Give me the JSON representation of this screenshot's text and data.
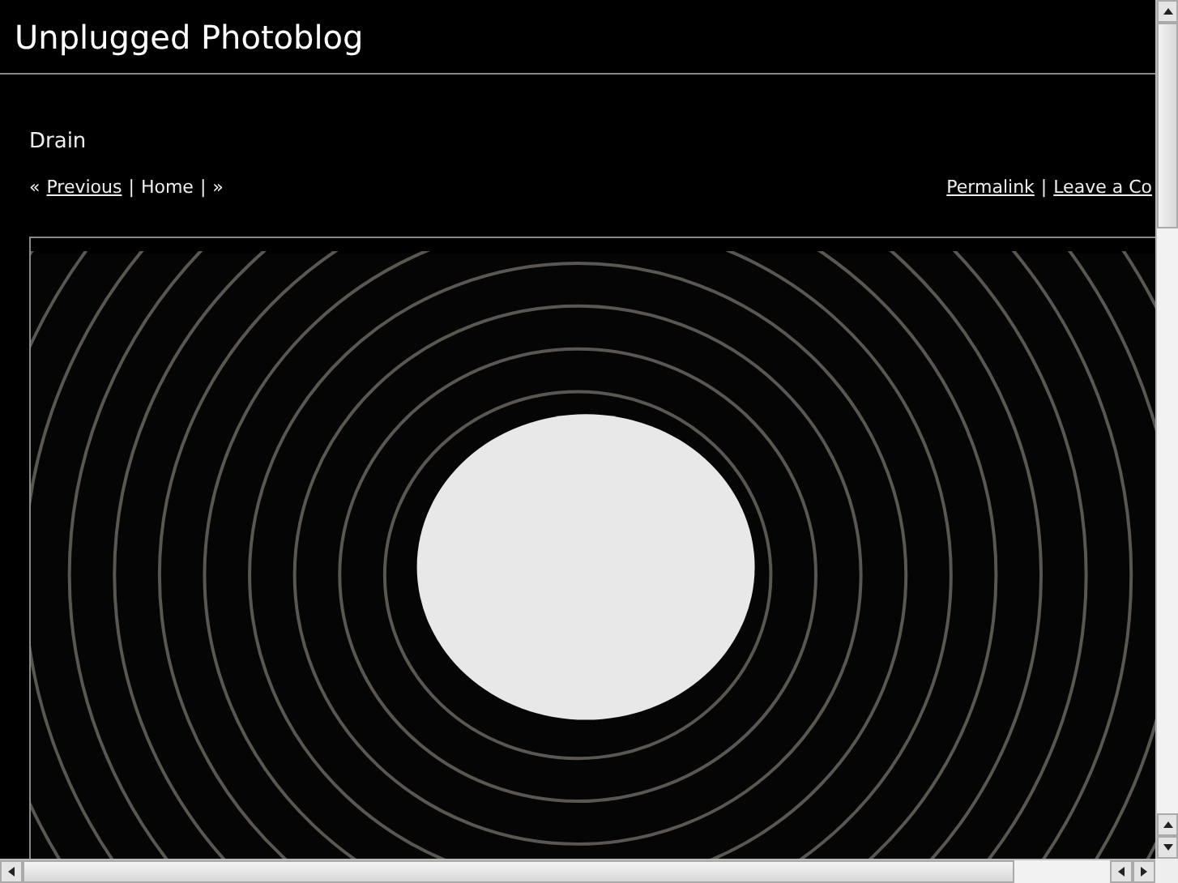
{
  "site_title": "Unplugged Photoblog",
  "post_title": "Drain",
  "nav_left": [
    {
      "kind": "text",
      "text": "«"
    },
    {
      "kind": "link",
      "text": "Previous"
    },
    {
      "kind": "separator",
      "text": "|"
    },
    {
      "kind": "text",
      "text": "Home"
    },
    {
      "kind": "separator",
      "text": "|"
    },
    {
      "kind": "text",
      "text": "»"
    }
  ],
  "nav_right": [
    {
      "kind": "link",
      "text": "Permalink"
    },
    {
      "kind": "separator",
      "text": "|"
    },
    {
      "kind": "link",
      "text": "Leave a Co"
    }
  ]
}
